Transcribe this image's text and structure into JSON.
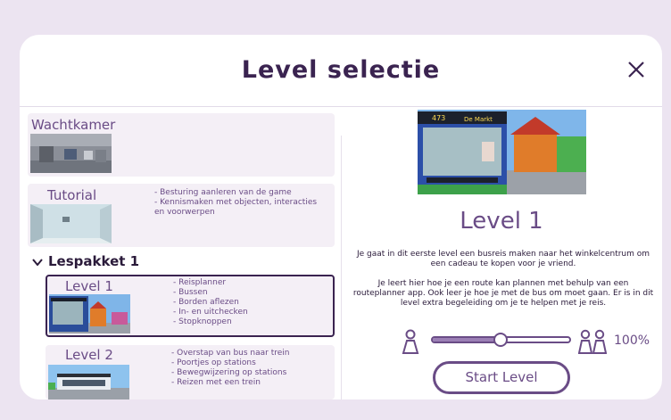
{
  "dialog": {
    "title": "Level selectie"
  },
  "levels_list": {
    "wachtkamer": {
      "name": "Wachtkamer"
    },
    "tutorial": {
      "name": "Tutorial",
      "features": [
        "- Besturing aanleren van de game",
        "- Kennismaken met objecten, interacties en voorwerpen"
      ]
    },
    "section": {
      "label": "Lespakket 1"
    },
    "level1": {
      "name": "Level 1",
      "features": [
        "- Reisplanner",
        "- Bussen",
        "- Borden aflezen",
        "- In- en uitchecken",
        "- Stopknoppen"
      ]
    },
    "level2": {
      "name": "Level 2",
      "features": [
        "- Overstap van bus naar trein",
        "- Poortjes op stations",
        "- Bewegwijzering op stations",
        "- Reizen met een trein"
      ]
    }
  },
  "detail": {
    "title": "Level 1",
    "bus_number": "473",
    "bus_destination": "De Markt",
    "description": [
      "Je gaat in dit eerste level een busreis maken naar het winkelcentrum om een cadeau te kopen voor je vriend.",
      "Je leert hier hoe je een route kan plannen met behulp van een routeplanner app. Ook leer je hoe je met de bus om moet gaan. Er is in dit level extra begeleiding om je te helpen met je reis."
    ],
    "guidance_percent_label": "100%",
    "guidance_level": 0.5,
    "start_label": "Start Level"
  },
  "colors": {
    "accent": "#6a4c86",
    "selected_border": "#3a2350",
    "card_bg": "#f4eff6",
    "page_bg": "#ece4f1"
  },
  "icons": {
    "close": "close-icon",
    "chevron": "chevron-down-icon",
    "single": "single-person-icon",
    "group": "group-person-icon"
  }
}
